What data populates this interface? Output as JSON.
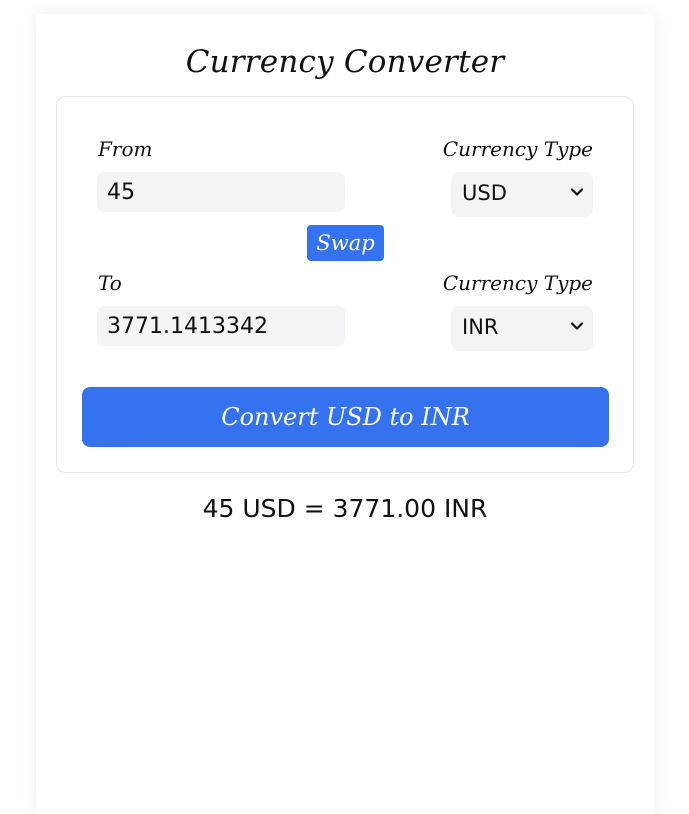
{
  "app": {
    "title": "Currency Converter"
  },
  "from": {
    "label": "From",
    "amount": "45",
    "currency_label": "Currency Type",
    "currency": "USD"
  },
  "swap": {
    "label": "Swap"
  },
  "to": {
    "label": "To",
    "amount": "3771.1413342",
    "currency_label": "Currency Type",
    "currency": "INR"
  },
  "convert": {
    "label": "Convert USD to INR"
  },
  "result": {
    "text": "45 USD = 3771.00 INR"
  },
  "colors": {
    "accent": "#3572ef",
    "input_bg": "#f3f4f6",
    "card_border": "#e5e7eb"
  },
  "icons": {
    "select_indicator": "chevron-down-icon"
  }
}
